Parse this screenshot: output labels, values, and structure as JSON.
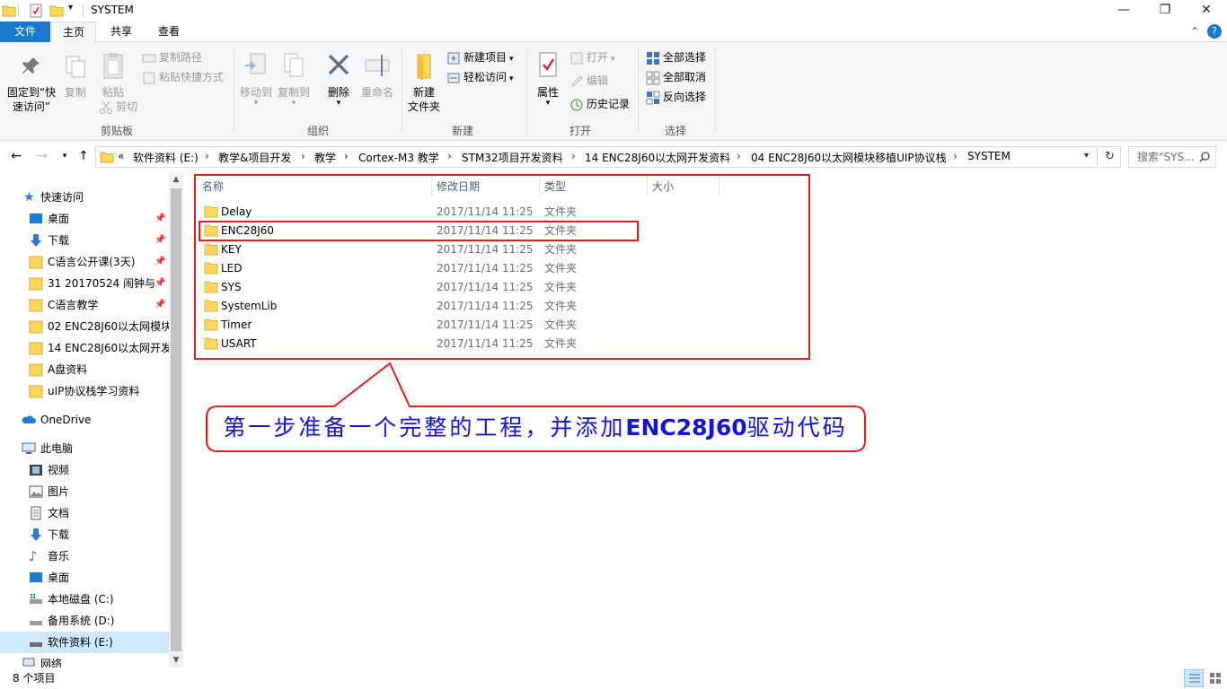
{
  "window": {
    "title": "SYSTEM",
    "minimize": "—",
    "restore": "❐",
    "close": "✕"
  },
  "tabs": {
    "file": "文件",
    "home": "主页",
    "share": "共享",
    "view": "查看",
    "expand": "⌃",
    "help": "?"
  },
  "ribbon": {
    "clipboard": {
      "label": "剪贴板",
      "pin_line1": "固定到“快",
      "pin_line2": "速访问”",
      "copy": "复制",
      "paste": "粘贴",
      "copy_path": "复制路径",
      "paste_shortcut": "粘贴快捷方式",
      "cut": "剪切"
    },
    "organize": {
      "label": "组织",
      "move_to": "移动到",
      "copy_to": "复制到",
      "delete": "删除",
      "rename": "重命名"
    },
    "new": {
      "label": "新建",
      "new_folder_line1": "新建",
      "new_folder_line2": "文件夹",
      "new_item": "新建项目",
      "easy_access": "轻松访问"
    },
    "open": {
      "label": "打开",
      "properties": "属性",
      "open": "打开",
      "edit": "编辑",
      "history": "历史记录"
    },
    "select": {
      "label": "选择",
      "select_all": "全部选择",
      "select_none": "全部取消",
      "invert": "反向选择"
    }
  },
  "address": {
    "overflow": "«",
    "segments": [
      "软件资料 (E:)",
      "教学&项目开发",
      "教学",
      "Cortex-M3 教学",
      "STM32项目开发资料",
      "14 ENC28J60以太网开发资料",
      "04 ENC28J60以太网模块移植UIP协议栈",
      "SYSTEM"
    ],
    "search_placeholder": "搜索\"SYS..."
  },
  "nav": {
    "quick_access": "快速访问",
    "items": [
      {
        "label": "桌面",
        "pinned": true
      },
      {
        "label": "下载",
        "pinned": true
      },
      {
        "label": "C语言公开课(3天)",
        "pinned": true
      },
      {
        "label": "31 20170524 闹钟与",
        "pinned": true
      },
      {
        "label": "C语言教学",
        "pinned": true
      },
      {
        "label": "02 ENC28J60以太网模块",
        "pinned": false
      },
      {
        "label": "14 ENC28J60以太网开发",
        "pinned": false
      },
      {
        "label": "A盘资料",
        "pinned": false
      },
      {
        "label": "uIP协议栈学习资料",
        "pinned": false
      }
    ],
    "onedrive": "OneDrive",
    "this_pc": "此电脑",
    "pc_items": [
      "视频",
      "图片",
      "文档",
      "下载",
      "音乐",
      "桌面"
    ],
    "drives": [
      "本地磁盘 (C:)",
      "备用系统 (D:)",
      "软件资料 (E:)",
      "网络"
    ]
  },
  "columns": {
    "name": "名称",
    "date": "修改日期",
    "type": "类型",
    "size": "大小"
  },
  "files": [
    {
      "name": "Delay",
      "date": "2017/11/14 11:25",
      "type": "文件夹"
    },
    {
      "name": "ENC28J60",
      "date": "2017/11/14 11:25",
      "type": "文件夹"
    },
    {
      "name": "KEY",
      "date": "2017/11/14 11:25",
      "type": "文件夹"
    },
    {
      "name": "LED",
      "date": "2017/11/14 11:25",
      "type": "文件夹"
    },
    {
      "name": "SYS",
      "date": "2017/11/14 11:25",
      "type": "文件夹"
    },
    {
      "name": "SystemLib",
      "date": "2017/11/14 11:25",
      "type": "文件夹"
    },
    {
      "name": "Timer",
      "date": "2017/11/14 11:25",
      "type": "文件夹"
    },
    {
      "name": "USART",
      "date": "2017/11/14 11:25",
      "type": "文件夹"
    }
  ],
  "annotation": {
    "part1": "第一步准备一个完整的工程，并添加",
    "part2": "ENC28J60",
    "part3": "驱动代码"
  },
  "status": {
    "item_count": "8 个项目"
  },
  "colors": {
    "accent": "#1979ca",
    "folder": "#ffd75e",
    "annotation_red": "#e21d1d",
    "annotation_blue": "#1414d4",
    "selected": "#cde8ff"
  }
}
